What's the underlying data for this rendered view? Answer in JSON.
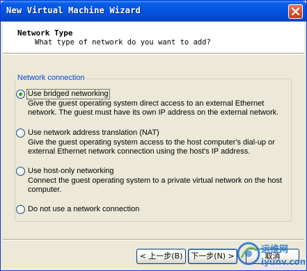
{
  "window": {
    "title": "New Virtual Machine Wizard"
  },
  "header": {
    "title": "Network Type",
    "subtitle": "What type of network do you want to add?"
  },
  "group": {
    "legend": "Network connection"
  },
  "options": [
    {
      "label": "Use bridged networking",
      "description": "Give the guest operating system direct access to an external Ethernet network. The guest must have its own IP address on the external network.",
      "selected": true
    },
    {
      "label": "Use network address translation (NAT)",
      "description": "Give the guest operating system access to the host computer's dial-up or external Ethernet network connection using the host's IP address.",
      "selected": false
    },
    {
      "label": "Use host-only networking",
      "description": "Connect the guest operating system to a private virtual network on the host computer.",
      "selected": false
    },
    {
      "label": "Do not use a network connection",
      "description": "",
      "selected": false
    }
  ],
  "buttons": {
    "back": "< 上一步(B)",
    "next": "下一步(N) >",
    "cancel": "取消"
  },
  "watermark": {
    "cn": "运维网",
    "url": "iyunv.com"
  },
  "colors": {
    "titlebar": "#0454e0",
    "legend": "#0046d5",
    "radio_dot": "#21a121",
    "face": "#ece9d8"
  },
  "icons": {
    "close": "close-icon"
  }
}
